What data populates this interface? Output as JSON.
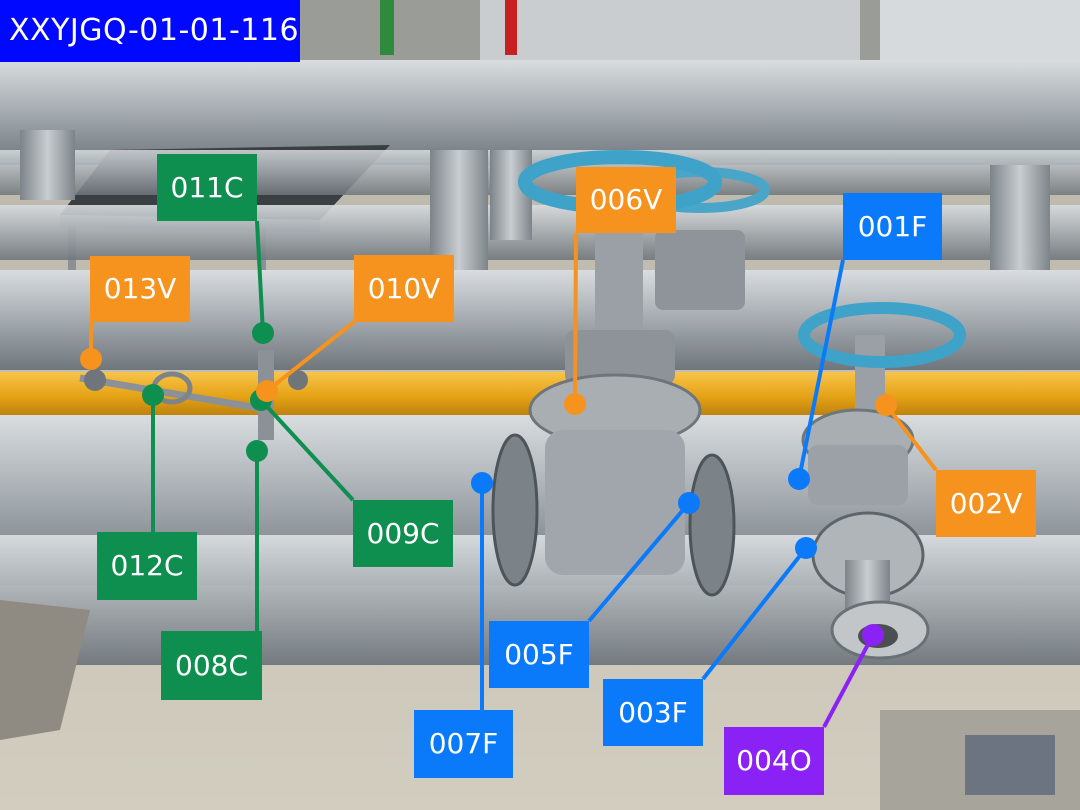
{
  "title": "XXYJGQ-01-01-116",
  "colors": {
    "V": "#F6921E",
    "F": "#0A7AFB",
    "C": "#0E8F4F",
    "O": "#8A21F5",
    "title_bg": "#0008FF"
  },
  "labels": [
    {
      "id": "001F",
      "type": "F"
    },
    {
      "id": "002V",
      "type": "V"
    },
    {
      "id": "003F",
      "type": "F"
    },
    {
      "id": "004O",
      "type": "O"
    },
    {
      "id": "005F",
      "type": "F"
    },
    {
      "id": "006V",
      "type": "V"
    },
    {
      "id": "007F",
      "type": "F"
    },
    {
      "id": "008C",
      "type": "C"
    },
    {
      "id": "009C",
      "type": "C"
    },
    {
      "id": "010V",
      "type": "V"
    },
    {
      "id": "011C",
      "type": "C"
    },
    {
      "id": "012C",
      "type": "C"
    },
    {
      "id": "013V",
      "type": "V"
    }
  ]
}
